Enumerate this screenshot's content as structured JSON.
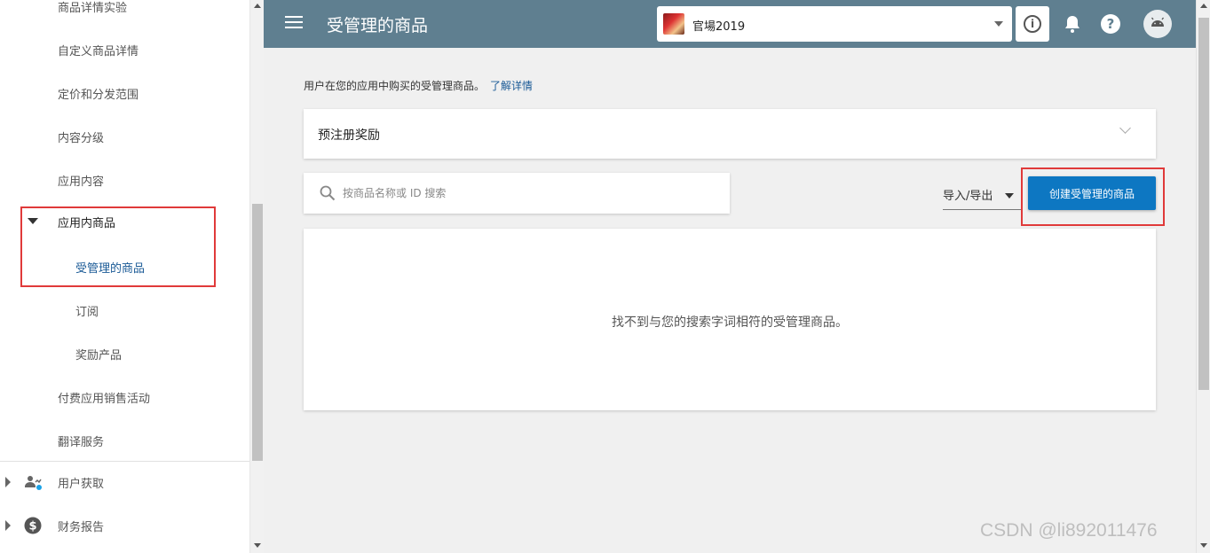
{
  "sidebar": {
    "items": [
      {
        "label": "商品详情实验"
      },
      {
        "label": "自定义商品详情"
      },
      {
        "label": "定价和分发范围"
      },
      {
        "label": "内容分级"
      },
      {
        "label": "应用内容"
      },
      {
        "label": "应用内商品"
      },
      {
        "label": "受管理的商品"
      },
      {
        "label": "订阅"
      },
      {
        "label": "奖励产品"
      },
      {
        "label": "付费应用销售活动"
      },
      {
        "label": "翻译服务"
      },
      {
        "label": "用户获取",
        "icon": "user-acquisition-icon"
      },
      {
        "label": "财务报告",
        "icon": "dollar-icon"
      }
    ]
  },
  "header": {
    "title": "受管理的商品",
    "app_name": "官場2019",
    "info_icon": "i",
    "help_icon": "?"
  },
  "main": {
    "intro_text": "用户在您的应用中购买的受管理商品。",
    "learn_more": "了解详情",
    "prereg_title": "预注册奖励",
    "search_placeholder": "按商品名称或 ID 搜索",
    "import_export": "导入/导出",
    "create_button": "创建受管理的商品",
    "empty_message": "找不到与您的搜索字词相符的受管理商品。"
  },
  "watermark": "CSDN @li892011476",
  "colors": {
    "header_bg": "#5f7f90",
    "primary_button": "#0d77c2",
    "link": "#1a5a96",
    "highlight_border": "#e03a3a"
  }
}
